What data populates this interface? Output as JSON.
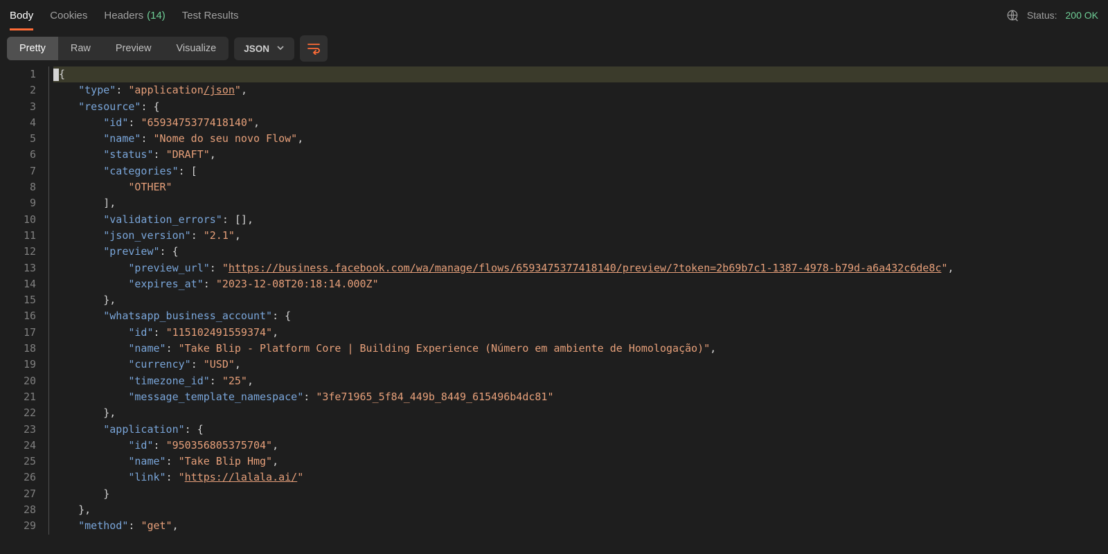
{
  "tabs": {
    "body": "Body",
    "cookies": "Cookies",
    "headers": "Headers",
    "headers_count": "(14)",
    "test_results": "Test Results"
  },
  "status": {
    "label": "Status:",
    "value": "200 OK"
  },
  "view_modes": {
    "pretty": "Pretty",
    "raw": "Raw",
    "preview": "Preview",
    "visualize": "Visualize"
  },
  "format_select": "JSON",
  "code": {
    "lines": [
      [
        {
          "cls": "cursor",
          "txt": ""
        },
        {
          "cls": "tk-punc",
          "txt": "{"
        }
      ],
      [
        {
          "cls": "ind",
          "n": 1
        },
        {
          "cls": "tk-key",
          "txt": "\"type\""
        },
        {
          "cls": "tk-punc",
          "txt": ": "
        },
        {
          "cls": "tk-str",
          "txt": "\"application"
        },
        {
          "cls": "tk-link",
          "txt": "/json"
        },
        {
          "cls": "tk-str",
          "txt": "\""
        },
        {
          "cls": "tk-punc",
          "txt": ","
        }
      ],
      [
        {
          "cls": "ind",
          "n": 1
        },
        {
          "cls": "tk-key",
          "txt": "\"resource\""
        },
        {
          "cls": "tk-punc",
          "txt": ": {"
        }
      ],
      [
        {
          "cls": "ind",
          "n": 2
        },
        {
          "cls": "tk-key",
          "txt": "\"id\""
        },
        {
          "cls": "tk-punc",
          "txt": ": "
        },
        {
          "cls": "tk-str",
          "txt": "\"6593475377418140\""
        },
        {
          "cls": "tk-punc",
          "txt": ","
        }
      ],
      [
        {
          "cls": "ind",
          "n": 2
        },
        {
          "cls": "tk-key",
          "txt": "\"name\""
        },
        {
          "cls": "tk-punc",
          "txt": ": "
        },
        {
          "cls": "tk-str",
          "txt": "\"Nome do seu novo Flow\""
        },
        {
          "cls": "tk-punc",
          "txt": ","
        }
      ],
      [
        {
          "cls": "ind",
          "n": 2
        },
        {
          "cls": "tk-key",
          "txt": "\"status\""
        },
        {
          "cls": "tk-punc",
          "txt": ": "
        },
        {
          "cls": "tk-str",
          "txt": "\"DRAFT\""
        },
        {
          "cls": "tk-punc",
          "txt": ","
        }
      ],
      [
        {
          "cls": "ind",
          "n": 2
        },
        {
          "cls": "tk-key",
          "txt": "\"categories\""
        },
        {
          "cls": "tk-punc",
          "txt": ": ["
        }
      ],
      [
        {
          "cls": "ind",
          "n": 3
        },
        {
          "cls": "tk-str",
          "txt": "\"OTHER\""
        }
      ],
      [
        {
          "cls": "ind",
          "n": 2
        },
        {
          "cls": "tk-punc",
          "txt": "],"
        }
      ],
      [
        {
          "cls": "ind",
          "n": 2
        },
        {
          "cls": "tk-key",
          "txt": "\"validation_errors\""
        },
        {
          "cls": "tk-punc",
          "txt": ": [],"
        }
      ],
      [
        {
          "cls": "ind",
          "n": 2
        },
        {
          "cls": "tk-key",
          "txt": "\"json_version\""
        },
        {
          "cls": "tk-punc",
          "txt": ": "
        },
        {
          "cls": "tk-str",
          "txt": "\"2.1\""
        },
        {
          "cls": "tk-punc",
          "txt": ","
        }
      ],
      [
        {
          "cls": "ind",
          "n": 2
        },
        {
          "cls": "tk-key",
          "txt": "\"preview\""
        },
        {
          "cls": "tk-punc",
          "txt": ": {"
        }
      ],
      [
        {
          "cls": "ind",
          "n": 3
        },
        {
          "cls": "tk-key",
          "txt": "\"preview_url\""
        },
        {
          "cls": "tk-punc",
          "txt": ": "
        },
        {
          "cls": "tk-str",
          "txt": "\""
        },
        {
          "cls": "tk-link",
          "txt": "https://business.facebook.com/wa/manage/flows/6593475377418140/preview/?token=2b69b7c1-1387-4978-b79d-a6a432c6de8c"
        },
        {
          "cls": "tk-str",
          "txt": "\""
        },
        {
          "cls": "tk-punc",
          "txt": ","
        }
      ],
      [
        {
          "cls": "ind",
          "n": 3
        },
        {
          "cls": "tk-key",
          "txt": "\"expires_at\""
        },
        {
          "cls": "tk-punc",
          "txt": ": "
        },
        {
          "cls": "tk-str",
          "txt": "\"2023-12-08T20:18:14.000Z\""
        }
      ],
      [
        {
          "cls": "ind",
          "n": 2
        },
        {
          "cls": "tk-punc",
          "txt": "},"
        }
      ],
      [
        {
          "cls": "ind",
          "n": 2
        },
        {
          "cls": "tk-key",
          "txt": "\"whatsapp_business_account\""
        },
        {
          "cls": "tk-punc",
          "txt": ": {"
        }
      ],
      [
        {
          "cls": "ind",
          "n": 3
        },
        {
          "cls": "tk-key",
          "txt": "\"id\""
        },
        {
          "cls": "tk-punc",
          "txt": ": "
        },
        {
          "cls": "tk-str",
          "txt": "\"115102491559374\""
        },
        {
          "cls": "tk-punc",
          "txt": ","
        }
      ],
      [
        {
          "cls": "ind",
          "n": 3
        },
        {
          "cls": "tk-key",
          "txt": "\"name\""
        },
        {
          "cls": "tk-punc",
          "txt": ": "
        },
        {
          "cls": "tk-str",
          "txt": "\"Take Blip - Platform Core | Building Experience (Número em ambiente de Homologação)\""
        },
        {
          "cls": "tk-punc",
          "txt": ","
        }
      ],
      [
        {
          "cls": "ind",
          "n": 3
        },
        {
          "cls": "tk-key",
          "txt": "\"currency\""
        },
        {
          "cls": "tk-punc",
          "txt": ": "
        },
        {
          "cls": "tk-str",
          "txt": "\"USD\""
        },
        {
          "cls": "tk-punc",
          "txt": ","
        }
      ],
      [
        {
          "cls": "ind",
          "n": 3
        },
        {
          "cls": "tk-key",
          "txt": "\"timezone_id\""
        },
        {
          "cls": "tk-punc",
          "txt": ": "
        },
        {
          "cls": "tk-str",
          "txt": "\"25\""
        },
        {
          "cls": "tk-punc",
          "txt": ","
        }
      ],
      [
        {
          "cls": "ind",
          "n": 3
        },
        {
          "cls": "tk-key",
          "txt": "\"message_template_namespace\""
        },
        {
          "cls": "tk-punc",
          "txt": ": "
        },
        {
          "cls": "tk-str",
          "txt": "\"3fe71965_5f84_449b_8449_615496b4dc81\""
        }
      ],
      [
        {
          "cls": "ind",
          "n": 2
        },
        {
          "cls": "tk-punc",
          "txt": "},"
        }
      ],
      [
        {
          "cls": "ind",
          "n": 2
        },
        {
          "cls": "tk-key",
          "txt": "\"application\""
        },
        {
          "cls": "tk-punc",
          "txt": ": {"
        }
      ],
      [
        {
          "cls": "ind",
          "n": 3
        },
        {
          "cls": "tk-key",
          "txt": "\"id\""
        },
        {
          "cls": "tk-punc",
          "txt": ": "
        },
        {
          "cls": "tk-str",
          "txt": "\"950356805375704\""
        },
        {
          "cls": "tk-punc",
          "txt": ","
        }
      ],
      [
        {
          "cls": "ind",
          "n": 3
        },
        {
          "cls": "tk-key",
          "txt": "\"name\""
        },
        {
          "cls": "tk-punc",
          "txt": ": "
        },
        {
          "cls": "tk-str",
          "txt": "\"Take Blip Hmg\""
        },
        {
          "cls": "tk-punc",
          "txt": ","
        }
      ],
      [
        {
          "cls": "ind",
          "n": 3
        },
        {
          "cls": "tk-key",
          "txt": "\"link\""
        },
        {
          "cls": "tk-punc",
          "txt": ": "
        },
        {
          "cls": "tk-str",
          "txt": "\""
        },
        {
          "cls": "tk-link",
          "txt": "https://lalala.ai/"
        },
        {
          "cls": "tk-str",
          "txt": "\""
        }
      ],
      [
        {
          "cls": "ind",
          "n": 2
        },
        {
          "cls": "tk-punc",
          "txt": "}"
        }
      ],
      [
        {
          "cls": "ind",
          "n": 1
        },
        {
          "cls": "tk-punc",
          "txt": "},"
        }
      ],
      [
        {
          "cls": "ind",
          "n": 1
        },
        {
          "cls": "tk-key",
          "txt": "\"method\""
        },
        {
          "cls": "tk-punc",
          "txt": ": "
        },
        {
          "cls": "tk-str",
          "txt": "\"get\""
        },
        {
          "cls": "tk-punc",
          "txt": ","
        }
      ]
    ]
  }
}
